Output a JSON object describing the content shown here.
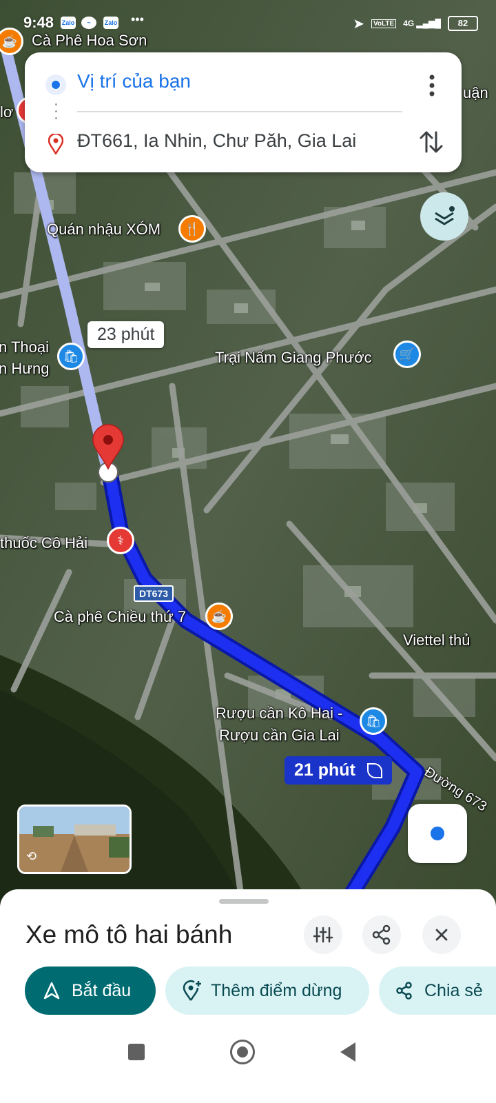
{
  "status_bar": {
    "time": "9:48",
    "apps": [
      "Zalo",
      "Messenger",
      "Zalo"
    ],
    "more": "•••",
    "network": "VoLTE",
    "signal": "4G",
    "battery": "82"
  },
  "directions": {
    "origin": "Vị trí của bạn",
    "destination": "ĐT661, Ia Nhin, Chư Păh, Gia Lai"
  },
  "map": {
    "places": [
      {
        "name": "Cà Phê Hoa Sơn",
        "icon": "coffee-icon"
      },
      {
        "name": "Quán nhậu XÓM",
        "icon": "restaurant-icon"
      },
      {
        "name": "n Thoại",
        "icon": "shopping-bag-icon"
      },
      {
        "name": "n Hưng",
        "icon": "shopping-bag-icon"
      },
      {
        "name": "Trại Nấm Giang Phước",
        "icon": "cart-icon"
      },
      {
        "name": "thuốc Cô Hải",
        "icon": "pharmacy-icon"
      },
      {
        "name": "Cà phê Chiều thứ 7",
        "icon": "coffee-icon"
      },
      {
        "name": "Viettel thủ",
        "icon": ""
      },
      {
        "name": "Rượu cần Kô Hai -",
        "icon": "shopping-bag-icon"
      },
      {
        "name": "Rượu cần Gia Lai",
        "icon": ""
      },
      {
        "name": "lơ",
        "icon": ""
      },
      {
        "name": "uận",
        "icon": ""
      }
    ],
    "road_label": "Đường 673",
    "road_shield": "DT673",
    "alt_route_time": "23 phút",
    "main_route_time": "21 phút",
    "colors": {
      "route": "#1a1aff",
      "alt_route": "#aeb8f0",
      "accent": "#006c72",
      "pin": "#e53935"
    }
  },
  "sheet": {
    "mode_title": "Xe mô tô hai bánh",
    "actions": {
      "start": "Bắt đầu",
      "add_stop": "Thêm điểm dừng",
      "share": "Chia sẻ"
    }
  }
}
